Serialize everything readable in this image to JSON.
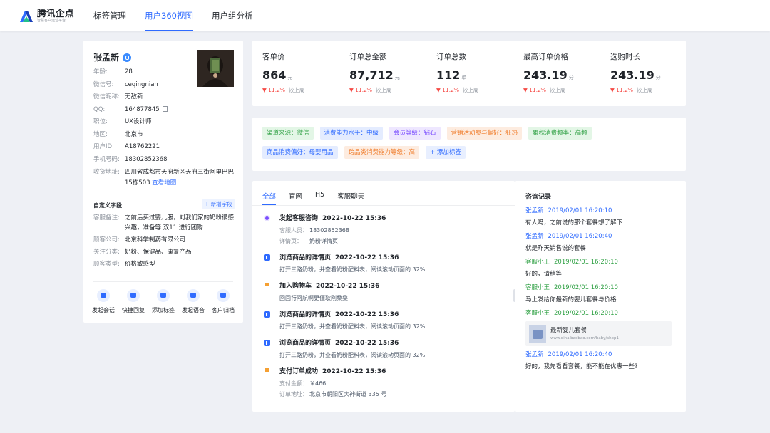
{
  "header": {
    "logo_title": "腾讯企点",
    "logo_subtitle": "智慧客户运营平台",
    "nav": [
      {
        "label": "标签管理",
        "active": false
      },
      {
        "label": "用户360视图",
        "active": true
      },
      {
        "label": "用户组分析",
        "active": false
      }
    ]
  },
  "profile": {
    "name": "张孟新",
    "fields": [
      {
        "label": "年龄:",
        "value": "28"
      },
      {
        "label": "微信号:",
        "value": "ceqingnian"
      },
      {
        "label": "微信昵称:",
        "value": "无敌新"
      },
      {
        "label": "QQ:",
        "value": "164877845"
      },
      {
        "label": "职位:",
        "value": "UX设计师"
      },
      {
        "label": "地区:",
        "value": "北京市"
      },
      {
        "label": "用户ID:",
        "value": "A18762221"
      },
      {
        "label": "手机号码:",
        "value": "18302852368"
      },
      {
        "label": "收货地址:",
        "value": "四川省成都市天府新区天府三街阿里巴巴15栋503",
        "link": "查看地图"
      }
    ],
    "custom_title": "自定义字段",
    "add_field": "+ 新增字段",
    "custom_fields": [
      {
        "label": "客服备注:",
        "value": "之前后买过婴儿服，对我们家的奶粉很感兴趣，准备等 双11 进行团购"
      },
      {
        "label": "顾客公司:",
        "value": "北京科学制药有限公司"
      },
      {
        "label": "关注分类:",
        "value": "奶粉、保健品、康复产品"
      },
      {
        "label": "顾客类型:",
        "value": "价格敏感型"
      }
    ],
    "actions": [
      {
        "label": "发起会话",
        "icon": "chat-icon"
      },
      {
        "label": "快捷回复",
        "icon": "quick-reply-icon"
      },
      {
        "label": "添加标签",
        "icon": "tag-icon"
      },
      {
        "label": "发起语音",
        "icon": "phone-icon"
      },
      {
        "label": "客户归档",
        "icon": "archive-icon"
      }
    ]
  },
  "stats": [
    {
      "label": "客单价",
      "value": "864",
      "unit": "元",
      "trend": "11.2%",
      "compare": "较上周"
    },
    {
      "label": "订单总金额",
      "value": "87,712",
      "unit": "元",
      "trend": "11.2%",
      "compare": "较上周"
    },
    {
      "label": "订单总数",
      "value": "112",
      "unit": "单",
      "trend": "11.2%",
      "compare": "较上周"
    },
    {
      "label": "最高订单价格",
      "value": "243.19",
      "unit": "分",
      "trend": "11.2%",
      "compare": "较上周"
    },
    {
      "label": "选购时长",
      "value": "243.19",
      "unit": "分",
      "trend": "11.2%",
      "compare": "较上周"
    }
  ],
  "tags": {
    "row1": [
      {
        "label": "渠道来源：微信",
        "color": "green"
      },
      {
        "label": "消费能力水平：中级",
        "color": "blue"
      },
      {
        "label": "会员等级：钻石",
        "color": "purple"
      },
      {
        "label": "营销活动参与偏好：狂热",
        "color": "orange"
      },
      {
        "label": "累积消费频率：高频",
        "color": "green"
      }
    ],
    "row2": [
      {
        "label": "商品消费偏好：母婴用品",
        "color": "blue"
      },
      {
        "label": "跨品类消费能力等级：高",
        "color": "orange"
      }
    ],
    "add_label": "+ 添加标签"
  },
  "activity": {
    "tabs": [
      {
        "label": "全部",
        "active": true
      },
      {
        "label": "官网",
        "active": false
      },
      {
        "label": "H5",
        "active": false
      },
      {
        "label": "客服聊天",
        "active": false
      }
    ],
    "events": [
      {
        "icon": "circle",
        "title": "发起客服咨询",
        "time": "2022-10-22 15:36",
        "lines": [
          {
            "label": "客服人员：",
            "value": "18302852368"
          },
          {
            "label": "详情页：",
            "value": "奶粉详情页"
          }
        ]
      },
      {
        "icon": "square",
        "title": "浏览商品的详情页",
        "time": "2022-10-22 15:36",
        "lines": [
          {
            "label": "",
            "value": "打开三路奶粉，并查看奶粉配料表，阅读滚动页面的 32%"
          }
        ]
      },
      {
        "icon": "flag",
        "title": "加入购物车",
        "time": "2022-10-22 15:36",
        "lines": [
          {
            "label": "",
            "value": "回回行阿航啊更僵耿刚桑桑"
          }
        ]
      },
      {
        "icon": "square",
        "title": "浏览商品的详情页",
        "time": "2022-10-22 15:36",
        "lines": [
          {
            "label": "",
            "value": "打开三路奶粉，并查看奶粉配料表，阅读滚动页面的 32%"
          }
        ]
      },
      {
        "icon": "square",
        "title": "浏览商品的详情页",
        "time": "2022-10-22 15:36",
        "lines": [
          {
            "label": "",
            "value": "打开三路奶粉，并查看奶粉配料表，阅读滚动页面的 32%"
          }
        ]
      },
      {
        "icon": "flag",
        "title": "支付订单成功",
        "time": "2022-10-22 15:36",
        "lines": [
          {
            "label": "支付金额：",
            "value": "￥466"
          },
          {
            "label": "订单地址：",
            "value": "北京市朝阳区大神街道 335 号"
          }
        ]
      }
    ]
  },
  "consult": {
    "title": "咨询记录",
    "messages": [
      {
        "sender": "张孟新",
        "role": "user",
        "time": "2019/02/01  16:20:10",
        "text": "有人吗，之前说的那个套餐想了解下"
      },
      {
        "sender": "张孟新",
        "role": "user",
        "time": "2019/02/01  16:20:40",
        "text": "就是昨天销售说的套餐"
      },
      {
        "sender": "客服小王",
        "role": "agent",
        "time": "2019/02/01  16:20:10",
        "text": "好的，请稍等"
      },
      {
        "sender": "客服小王",
        "role": "agent",
        "time": "2019/02/01  16:20:10",
        "text": "马上发给你最新的婴儿套餐与价格"
      },
      {
        "sender": "客服小王",
        "role": "agent",
        "time": "2019/02/01  16:20:10",
        "card": {
          "title": "最新婴儿套餐",
          "url": "www.qinaibaobao.com/baby/shop1"
        }
      },
      {
        "sender": "张孟新",
        "role": "user",
        "time": "2019/02/01  16:20:40",
        "text": "好的，我先看看套餐，能不能在优惠一些?"
      }
    ]
  }
}
